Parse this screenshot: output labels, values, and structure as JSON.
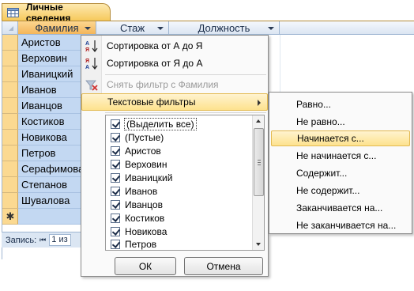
{
  "tab": {
    "title": "Личные сведения",
    "icon": "table-icon"
  },
  "grid": {
    "columns": [
      {
        "label": "Фамилия",
        "active": true
      },
      {
        "label": "Стаж",
        "active": false
      },
      {
        "label": "Должность",
        "active": false
      }
    ],
    "rows": [
      "Аристов",
      "Верховин",
      "Иваницкий",
      "Иванов",
      "Иванцов",
      "Костиков",
      "Новикова",
      "Петров",
      "Серафимова",
      "Степанов",
      "Шувалова"
    ],
    "new_row_marker": "✱"
  },
  "status_bar": {
    "label": "Запись:",
    "nav_first": "⏮",
    "record_value": "1 из"
  },
  "filter_menu": {
    "sort_asc": {
      "label": "Сортировка от А до Я",
      "icon": "sort-ascending-icon",
      "icon_text": "А\nЯ"
    },
    "sort_desc": {
      "label": "Сортировка от Я до А",
      "icon": "sort-descending-icon",
      "icon_text": "Я\nА"
    },
    "clear_filter": {
      "label": "Снять фильтр с Фамилия",
      "icon": "clear-filter-icon",
      "disabled": true
    },
    "text_filters": {
      "label": "Текстовые фильтры"
    },
    "values": [
      "(Выделить все)",
      "(Пустые)",
      "Аристов",
      "Верховин",
      "Иваницкий",
      "Иванов",
      "Иванцов",
      "Костиков",
      "Новикова",
      "Петров"
    ],
    "ok_label": "ОК",
    "cancel_label": "Отмена"
  },
  "text_filters_submenu": {
    "items": [
      "Равно...",
      "Не равно...",
      "Начинается с...",
      "Не начинается с...",
      "Содержит...",
      "Не содержит...",
      "Заканчивается на...",
      "Не заканчивается на..."
    ],
    "highlighted_index": 2
  },
  "colors": {
    "active_header": "#f4b65a",
    "selected_cell": "#c3d8f2",
    "highlight": "#fde28e"
  }
}
